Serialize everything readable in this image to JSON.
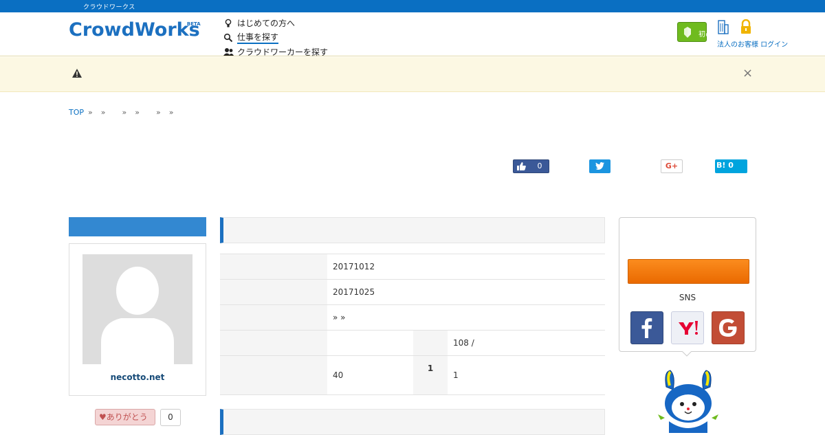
{
  "topbar": {
    "text": "クラウドワークス"
  },
  "header": {
    "logo_text": "CrowdWorks",
    "logo_beta": "BETA",
    "nav": [
      {
        "label": "はじめての方へ",
        "icon": "lightbulb-icon"
      },
      {
        "label": "仕事を探す",
        "icon": "search-icon"
      },
      {
        "label": "クラウドワーカーを探す",
        "icon": "users-icon"
      }
    ],
    "green_button_label": "初めての方",
    "links": "法人のお客様 ログイン"
  },
  "breadcrumb": {
    "top": "TOP"
  },
  "share": {
    "fb_count": "0",
    "gplus_label": "G+",
    "hatena_label": "B! 0"
  },
  "sidebar": {
    "profile_name": "necotto.net",
    "thanks_label": "♥ありがとう",
    "thanks_count": "0"
  },
  "details": {
    "rows": [
      {
        "value": "20171012"
      },
      {
        "value": "20171025"
      },
      {
        "value": "»    »"
      },
      {
        "value": "",
        "sub_value": "108 /"
      },
      {
        "value": "40",
        "sub_header": "1",
        "sub_value": "1"
      }
    ]
  },
  "login": {
    "sns_label": "SNS"
  },
  "colors": {
    "brand_blue": "#1c70c0",
    "topbar": "#0a6fc2",
    "orange": "#f57c00",
    "alert_bg": "#fcf8e3"
  }
}
